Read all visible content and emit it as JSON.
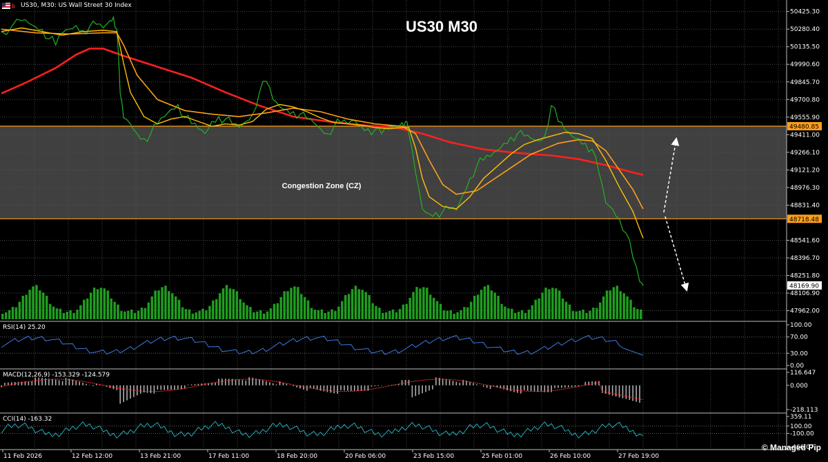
{
  "header": {
    "symbol_line": "US30, M30:  US Wall Street 30 Index"
  },
  "chart_data": {
    "type": "line",
    "title": "US30 M30",
    "price_axis": {
      "ylim": [
        47880,
        50520
      ],
      "ticks": [
        "50425.30",
        "50280.40",
        "50135.50",
        "49990.60",
        "49845.70",
        "49700.80",
        "49555.90",
        "49411.00",
        "49266.10",
        "49121.20",
        "48976.30",
        "48831.40",
        "48541.60",
        "48396.70",
        "48251.80",
        "48106.90",
        "47962.00"
      ]
    },
    "time_labels": [
      "11 Feb 2026",
      "12 Feb 12:00",
      "13 Feb 21:00",
      "17 Feb 11:00",
      "18 Feb 20:00",
      "20 Feb 06:00",
      "23 Feb 15:00",
      "25 Feb 01:00",
      "26 Feb 10:00",
      "27 Feb 19:00"
    ],
    "levels": [
      {
        "name": "top",
        "value": 49480.85,
        "label": "49480.85"
      },
      {
        "name": "bottom",
        "value": 48718.48,
        "label": "48718.48"
      }
    ],
    "current_price": {
      "value": 48169.9,
      "label": "48169.90"
    },
    "zone_label": "Congestion Zone (CZ)",
    "price_path": [
      [
        0,
        50260
      ],
      [
        3,
        50300
      ],
      [
        6,
        50350
      ],
      [
        8,
        50330
      ],
      [
        10,
        50300
      ],
      [
        12,
        50280
      ],
      [
        14,
        50200
      ],
      [
        16,
        50150
      ],
      [
        18,
        50250
      ],
      [
        20,
        50280
      ],
      [
        22,
        50310
      ],
      [
        24,
        50270
      ],
      [
        26,
        50300
      ],
      [
        28,
        50320
      ],
      [
        30,
        50290
      ],
      [
        32,
        50350
      ],
      [
        33,
        50380
      ],
      [
        34,
        50280
      ],
      [
        35,
        49750
      ],
      [
        36,
        49550
      ],
      [
        38,
        49500
      ],
      [
        40,
        49420
      ],
      [
        42,
        49380
      ],
      [
        44,
        49420
      ],
      [
        46,
        49500
      ],
      [
        48,
        49560
      ],
      [
        50,
        49620
      ],
      [
        52,
        49660
      ],
      [
        54,
        49550
      ],
      [
        56,
        49500
      ],
      [
        58,
        49460
      ],
      [
        60,
        49420
      ],
      [
        62,
        49520
      ],
      [
        64,
        49560
      ],
      [
        66,
        49540
      ],
      [
        68,
        49500
      ],
      [
        70,
        49470
      ],
      [
        72,
        49520
      ],
      [
        74,
        49580
      ],
      [
        76,
        49760
      ],
      [
        78,
        49850
      ],
      [
        80,
        49700
      ],
      [
        82,
        49640
      ],
      [
        84,
        49620
      ],
      [
        86,
        49600
      ],
      [
        88,
        49580
      ],
      [
        90,
        49540
      ],
      [
        92,
        49510
      ],
      [
        94,
        49460
      ],
      [
        96,
        49420
      ],
      [
        98,
        49480
      ],
      [
        100,
        49510
      ],
      [
        102,
        49500
      ],
      [
        104,
        49530
      ],
      [
        106,
        49480
      ],
      [
        108,
        49460
      ],
      [
        110,
        49450
      ],
      [
        112,
        49420
      ],
      [
        114,
        49470
      ],
      [
        116,
        49480
      ],
      [
        118,
        49510
      ],
      [
        119,
        49520
      ],
      [
        120,
        49420
      ],
      [
        122,
        49100
      ],
      [
        124,
        48800
      ],
      [
        126,
        48760
      ],
      [
        128,
        48770
      ],
      [
        130,
        48780
      ],
      [
        132,
        48800
      ],
      [
        134,
        48790
      ],
      [
        136,
        48920
      ],
      [
        138,
        49050
      ],
      [
        140,
        49150
      ],
      [
        142,
        49200
      ],
      [
        144,
        49230
      ],
      [
        146,
        49280
      ],
      [
        148,
        49340
      ],
      [
        150,
        49390
      ],
      [
        152,
        49420
      ],
      [
        154,
        49400
      ],
      [
        156,
        49380
      ],
      [
        158,
        49360
      ],
      [
        160,
        49400
      ],
      [
        162,
        49650
      ],
      [
        164,
        49520
      ],
      [
        166,
        49450
      ],
      [
        168,
        49400
      ],
      [
        170,
        49380
      ],
      [
        172,
        49340
      ],
      [
        174,
        49290
      ],
      [
        176,
        49100
      ],
      [
        178,
        48850
      ],
      [
        180,
        48800
      ],
      [
        182,
        48720
      ],
      [
        184,
        48600
      ],
      [
        186,
        48400
      ],
      [
        188,
        48200
      ],
      [
        189,
        48169.9
      ]
    ],
    "ema_fast": [
      [
        0,
        50260
      ],
      [
        6,
        50290
      ],
      [
        12,
        50260
      ],
      [
        18,
        50230
      ],
      [
        24,
        50260
      ],
      [
        30,
        50270
      ],
      [
        34,
        50260
      ],
      [
        36,
        50000
      ],
      [
        38,
        49760
      ],
      [
        42,
        49560
      ],
      [
        46,
        49500
      ],
      [
        50,
        49540
      ],
      [
        54,
        49560
      ],
      [
        58,
        49520
      ],
      [
        62,
        49480
      ],
      [
        66,
        49500
      ],
      [
        70,
        49490
      ],
      [
        74,
        49520
      ],
      [
        78,
        49620
      ],
      [
        82,
        49660
      ],
      [
        86,
        49640
      ],
      [
        90,
        49600
      ],
      [
        94,
        49550
      ],
      [
        98,
        49510
      ],
      [
        102,
        49500
      ],
      [
        106,
        49490
      ],
      [
        110,
        49470
      ],
      [
        114,
        49460
      ],
      [
        118,
        49470
      ],
      [
        120,
        49470
      ],
      [
        122,
        49300
      ],
      [
        124,
        49050
      ],
      [
        126,
        48900
      ],
      [
        130,
        48820
      ],
      [
        134,
        48800
      ],
      [
        138,
        48900
      ],
      [
        142,
        49050
      ],
      [
        146,
        49150
      ],
      [
        150,
        49250
      ],
      [
        154,
        49330
      ],
      [
        158,
        49370
      ],
      [
        162,
        49400
      ],
      [
        166,
        49430
      ],
      [
        170,
        49420
      ],
      [
        174,
        49380
      ],
      [
        178,
        49200
      ],
      [
        182,
        48980
      ],
      [
        186,
        48780
      ],
      [
        189,
        48560
      ]
    ],
    "ema_mid": [
      [
        0,
        50280
      ],
      [
        10,
        50250
      ],
      [
        20,
        50240
      ],
      [
        30,
        50250
      ],
      [
        34,
        50250
      ],
      [
        36,
        50150
      ],
      [
        40,
        49900
      ],
      [
        46,
        49700
      ],
      [
        54,
        49610
      ],
      [
        62,
        49580
      ],
      [
        70,
        49560
      ],
      [
        78,
        49590
      ],
      [
        86,
        49630
      ],
      [
        94,
        49600
      ],
      [
        102,
        49540
      ],
      [
        110,
        49500
      ],
      [
        118,
        49480
      ],
      [
        122,
        49420
      ],
      [
        126,
        49200
      ],
      [
        130,
        49000
      ],
      [
        134,
        48920
      ],
      [
        140,
        48950
      ],
      [
        148,
        49100
      ],
      [
        156,
        49250
      ],
      [
        164,
        49340
      ],
      [
        170,
        49370
      ],
      [
        174,
        49360
      ],
      [
        178,
        49280
      ],
      [
        182,
        49120
      ],
      [
        186,
        48960
      ],
      [
        189,
        48800
      ]
    ],
    "ema_slow": [
      [
        0,
        49750
      ],
      [
        8,
        49850
      ],
      [
        16,
        49960
      ],
      [
        22,
        50070
      ],
      [
        26,
        50120
      ],
      [
        30,
        50120
      ],
      [
        36,
        50060
      ],
      [
        46,
        49970
      ],
      [
        56,
        49880
      ],
      [
        66,
        49760
      ],
      [
        76,
        49650
      ],
      [
        86,
        49560
      ],
      [
        96,
        49520
      ],
      [
        106,
        49490
      ],
      [
        116,
        49470
      ],
      [
        124,
        49420
      ],
      [
        132,
        49350
      ],
      [
        142,
        49290
      ],
      [
        152,
        49260
      ],
      [
        162,
        49240
      ],
      [
        170,
        49210
      ],
      [
        178,
        49160
      ],
      [
        186,
        49100
      ],
      [
        189,
        49080
      ]
    ],
    "indicators": [
      {
        "name": "RSI(14) 25.20",
        "ticks": [
          "100.00",
          "70.00",
          "30.00",
          "0.00"
        ],
        "ylim": [
          0,
          100
        ]
      },
      {
        "name": "MACD(12,26,9) -153.329 -124.579",
        "ticks": [
          "116.647",
          "0.000",
          "-218.113"
        ],
        "ylim": [
          -218.113,
          116.647
        ]
      },
      {
        "name": "CCI(14) -163.32",
        "ticks": [
          "359.11",
          "100.00",
          "-100.00",
          "-466.07"
        ],
        "ylim": [
          -466.07,
          359.11
        ]
      }
    ],
    "colors": {
      "price": "#22b322",
      "ema_fast": "#ffc107",
      "ema_mid": "#ff9f1a",
      "ema_slow": "#ff2020",
      "level": "#ff9f1a",
      "zone": "#555555",
      "rsi": "#3d7be0",
      "cci": "#2aa9b5",
      "macd_hist": "#b0b0b0",
      "macd_signal": "#ff3030",
      "volume": "#1f9e1f"
    }
  },
  "credit": "© Managed Pip"
}
